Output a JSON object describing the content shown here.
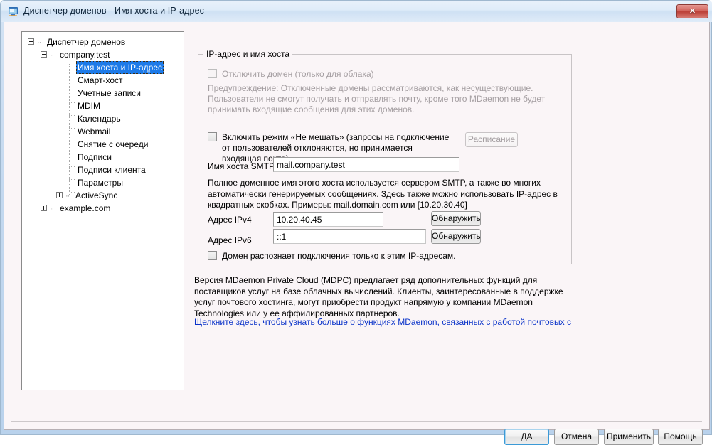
{
  "window": {
    "title": "Диспетчер доменов - Имя хоста и IP-адрес",
    "icon": "computer-monitor-icon",
    "close_label": "✕",
    "frame_color": "#c3d8ef",
    "client_bg": "#faf5f7"
  },
  "tree": {
    "nodes": [
      {
        "label": "Диспетчер доменов",
        "depth": 0,
        "expander": "minus",
        "selected": false
      },
      {
        "label": "company.test",
        "depth": 1,
        "expander": "minus",
        "selected": false
      },
      {
        "label": "Имя хоста и IP-адрес",
        "depth": 2,
        "expander": "none",
        "selected": true
      },
      {
        "label": "Смарт-хост",
        "depth": 2,
        "expander": "none",
        "selected": false
      },
      {
        "label": "Учетные записи",
        "depth": 2,
        "expander": "none",
        "selected": false
      },
      {
        "label": "MDIM",
        "depth": 2,
        "expander": "none",
        "selected": false
      },
      {
        "label": "Календарь",
        "depth": 2,
        "expander": "none",
        "selected": false
      },
      {
        "label": "Webmail",
        "depth": 2,
        "expander": "none",
        "selected": false
      },
      {
        "label": "Снятие с очереди",
        "depth": 2,
        "expander": "none",
        "selected": false
      },
      {
        "label": "Подписи",
        "depth": 2,
        "expander": "none",
        "selected": false
      },
      {
        "label": "Подписи клиента",
        "depth": 2,
        "expander": "none",
        "selected": false
      },
      {
        "label": "Параметры",
        "depth": 2,
        "expander": "none",
        "selected": false
      },
      {
        "label": "ActiveSync",
        "depth": 2,
        "expander": "plus",
        "selected": false
      },
      {
        "label": "example.com",
        "depth": 1,
        "expander": "plus",
        "selected": false
      }
    ],
    "selection_color": "#1d7ae8"
  },
  "group": {
    "title": "IP-адрес и имя хоста",
    "disable_domain": {
      "label": "Отключить домен (только для облака)",
      "checked": false,
      "enabled": false
    },
    "warning": "Предупреждение: Отключенные домены рассматриваются, как несуществующие. Пользователи не смогут получать и отправлять почту, кроме того MDaemon не будет принимать входящие сообщения для этих доменов.",
    "do_not_disturb": {
      "label": "Включить режим «Не мешать» (запросы на подключение от пользователей отклоняются, но принимается входящая почта)",
      "checked": false,
      "enabled": true
    },
    "schedule_button": {
      "label": "Расписание",
      "enabled": false
    },
    "smtp_host": {
      "label": "Имя хоста SMTP",
      "value": "mail.company.test",
      "placeholder": ""
    },
    "smtp_help": "Полное доменное имя этого хоста используется сервером SMTP, а также во многих автоматически генерируемых сообщениях.  Здесь также можно использовать IP-адрес в квадратных скобках.  Примеры:  mail.domain.com или [10.20.30.40]",
    "ipv4": {
      "label": "Адрес IPv4",
      "value": "10.20.40.45",
      "placeholder": "",
      "detect_label": "Обнаружить"
    },
    "ipv6": {
      "label": "Адрес IPv6",
      "value": "::1",
      "placeholder": "",
      "detect_label": "Обнаружить"
    },
    "only_these_ips": {
      "label": "Домен распознает подключения только к этим IP-адресам.",
      "checked": false,
      "enabled": true
    }
  },
  "info": {
    "paragraph": "Версия MDaemon Private Cloud (MDPC) предлагает ряд дополнительных функций для поставщиков услуг на базе облачных вычислений. Клиенты, заинтересованные в поддержке услуг почтового хостинга, могут приобрести продукт напрямую  у компании MDaemon Technologies или у ее аффилированных партнеров.",
    "link_text": "Щелкните здесь, чтобы узнать больше о функциях MDaemon, связанных с работой почтовых с",
    "link_color": "#0a33c9"
  },
  "footer": {
    "ok": "ДА",
    "cancel": "Отмена",
    "apply": "Применить",
    "help": "Помощь"
  }
}
